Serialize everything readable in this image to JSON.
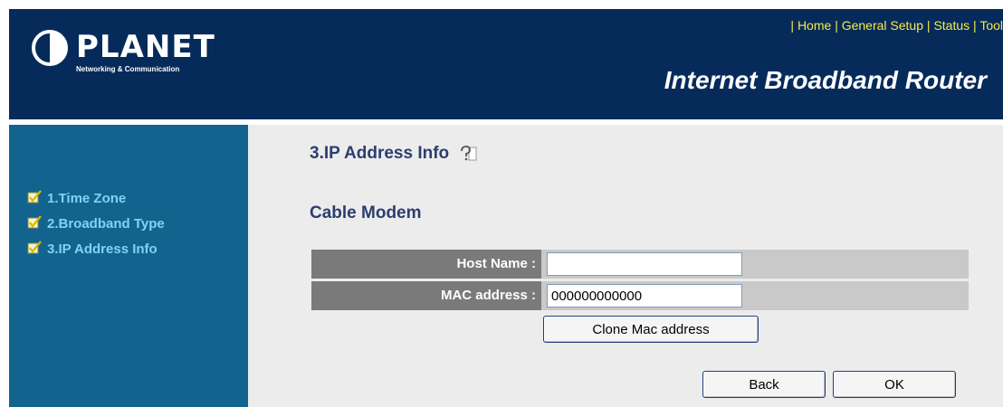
{
  "brand": {
    "name": "PLANET",
    "tagline": "Networking & Communication"
  },
  "topnav": {
    "sep": "|",
    "items": [
      "Home",
      "General Setup",
      "Status",
      "Tool"
    ]
  },
  "product_title": "Internet Broadband Router",
  "sidebar": {
    "items": [
      {
        "label": "1.Time Zone"
      },
      {
        "label": "2.Broadband Type"
      },
      {
        "label": "3.IP Address Info"
      }
    ]
  },
  "main": {
    "section_title": "3.IP Address Info",
    "subtitle": "Cable Modem",
    "fields": [
      {
        "label": "Host Name :",
        "value": ""
      },
      {
        "label": "MAC address :",
        "value": "000000000000"
      }
    ],
    "clone_button": "Clone Mac address",
    "back_button": "Back",
    "ok_button": "OK"
  },
  "colors": {
    "header_bg": "#062b5a",
    "sidebar_bg": "#13638f",
    "sidebar_text": "#7fd3f5",
    "nav_text": "#f5e94a",
    "content_bg": "#ececec",
    "label_bg": "#7a7a7a",
    "row_bg": "#c9c9c9",
    "title_text": "#2c3e6e"
  },
  "icons": {
    "logo": "planet-logo-icon",
    "check": "checkmark-icon",
    "help": "help-icon"
  }
}
